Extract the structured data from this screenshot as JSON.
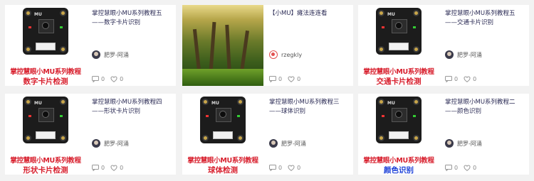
{
  "cards": [
    {
      "title": "掌控慧眼小MU系列教程五——数字卡片识别",
      "author": "肥罗-阿涌",
      "comments": "0",
      "likes": "0",
      "thumb": {
        "type": "board",
        "caption_line1": "掌控慧眼小MU系列教程",
        "caption_line2": "数字卡片检测",
        "caption2_color": "#d8202e"
      }
    },
    {
      "title": "【小MU】瘫法连连看",
      "author": "rzegkly",
      "comments": "0",
      "likes": "0",
      "thumb": {
        "type": "photo"
      }
    },
    {
      "title": "掌控慧眼小MU系列教程五——交通卡片识别",
      "author": "肥罗-阿涌",
      "comments": "0",
      "likes": "0",
      "thumb": {
        "type": "board",
        "caption_line1": "掌控慧眼小MU系列教程",
        "caption_line2": "交通卡片检测",
        "caption2_color": "#d8202e"
      }
    },
    {
      "title": "掌控慧眼小MU系列教程四——形状卡片识别",
      "author": "肥罗-阿涌",
      "comments": "0",
      "likes": "0",
      "thumb": {
        "type": "board",
        "caption_line1": "掌控慧眼小MU系列教程",
        "caption_line2": "形状卡片检测",
        "caption2_color": "#d8202e"
      }
    },
    {
      "title": "掌控慧眼小MU系列教程三——球体识别",
      "author": "肥罗-阿涌",
      "comments": "0",
      "likes": "0",
      "thumb": {
        "type": "board",
        "caption_line1": "掌控慧眼小MU系列教程",
        "caption_line2": "球体检测",
        "caption2_color": "#d8202e"
      }
    },
    {
      "title": "掌控慧眼小MU系列教程二——颜色识别",
      "author": "肥罗-阿涌",
      "comments": "0",
      "likes": "0",
      "thumb": {
        "type": "board",
        "caption_line1": "掌控慧眼小MU系列教程",
        "caption_line2": "颜色识别",
        "caption2_color": "#1a3fd8"
      }
    }
  ],
  "colors": {
    "title_text": "#2b2b55",
    "caption_red": "#d8202e",
    "caption_blue": "#1a3fd8",
    "page_bg": "#f2f2f2"
  },
  "icons": {
    "comment": "comment-icon",
    "like": "heart-icon"
  },
  "board_label": "MU"
}
